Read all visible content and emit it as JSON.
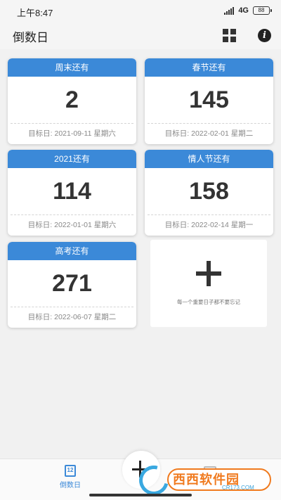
{
  "status_bar": {
    "time": "上午8:47",
    "network": "4G",
    "battery": "88"
  },
  "header": {
    "title": "倒数日",
    "grid_icon": "grid-icon",
    "info_icon": "info-icon"
  },
  "cards": [
    {
      "title": "周末还有",
      "days": "2",
      "target": "目标日: 2021-09-11 星期六"
    },
    {
      "title": "春节还有",
      "days": "145",
      "target": "目标日: 2022-02-01 星期二"
    },
    {
      "title": "2021还有",
      "days": "114",
      "target": "目标日: 2022-01-01 星期六"
    },
    {
      "title": "情人节还有",
      "days": "158",
      "target": "目标日: 2022-02-14 星期一"
    },
    {
      "title": "高考还有",
      "days": "271",
      "target": "目标日: 2022-06-07 星期二"
    }
  ],
  "add_card": {
    "hint": "每一个重要日子都不要忘记"
  },
  "bottom_bar": {
    "countdown_tab_label": "倒数日",
    "calendar_day": "12"
  },
  "watermark": {
    "text": "西西软件园",
    "sub": "CR173.COM"
  },
  "colors": {
    "accent": "#3b89d8",
    "background": "#f1f1f1",
    "watermark_orange": "#f07a1e"
  }
}
